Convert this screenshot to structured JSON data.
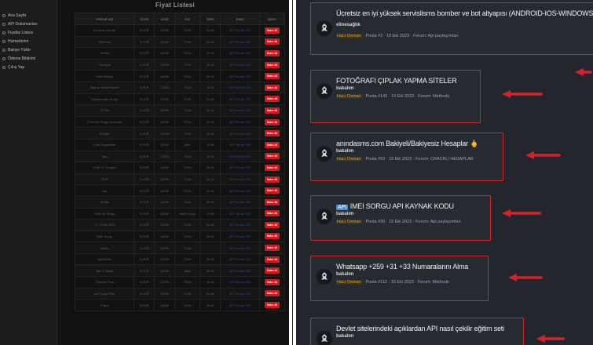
{
  "sidebar": {
    "items": [
      {
        "label": "Ana Sayfa"
      },
      {
        "label": "API Dokümanları"
      },
      {
        "label": "Fiyatlar Listesi"
      },
      {
        "label": "Hizmetlerim"
      },
      {
        "label": "Bakiye Yükle"
      },
      {
        "label": "Ödeme Bildirimi"
      },
      {
        "label": "Çıkış Yap"
      }
    ]
  },
  "content": {
    "title": "Fiyat Listesi",
    "table": {
      "headers": [
        "Hizmet Adı",
        "Ücret",
        "Limit",
        "Hız",
        "Süre",
        "Nasıl",
        "İşlem"
      ],
      "rows": [
        [
          "Ücretsiz Hizmet",
          "0,00 ₺",
          "10000",
          "7/24h",
          "10 dk",
          "API Servisi 100",
          "Satın Al"
        ],
        [
          "SMS Bot",
          "0,00 ₺",
          "10000",
          "7/24h",
          "10 dk",
          "API Servisi 100",
          "Satın Al"
        ],
        [
          "Yemek",
          "0,00 ₺",
          "10000",
          "7/24h",
          "10 dk",
          "API Servisi 100",
          "Satın Al"
        ],
        [
          "Trendyol",
          "0,00 ₺",
          "10000",
          "7/24h",
          "10 dk",
          "API Servisi 100",
          "Satın Al"
        ],
        [
          "Getir Market",
          "0,00 ₺",
          "10000",
          "7/24h",
          "10 dk",
          "API Servisi 100",
          "Satın Al"
        ],
        [
          "Migros Sanal Market",
          "0,00 ₺",
          "10000",
          "7/24h",
          "10 dk",
          "API Servisi 100",
          "Satın Al"
        ],
        [
          "Hepsiburada Sorgu",
          "0,00 ₺",
          "10000",
          "7/24h",
          "10 dk",
          "API Servisi 100",
          "Satın Al"
        ],
        [
          "TC Pro",
          "0,00 ₺",
          "10000",
          "7/24h",
          "10 dk",
          "API Servisi 100",
          "Satın Al"
        ],
        [
          "E-Devlet Sorgu & Hesap",
          "0,00 ₺",
          "10000",
          "7/24h",
          "10 dk",
          "API Servisi 100",
          "Satın Al"
        ],
        [
          "Ehliyet",
          "0,00 ₺",
          "10000",
          "7/24h",
          "10 dk",
          "API Servisi 100",
          "Satın Al"
        ],
        [
          "Sulu Sorgulama",
          "0,00 ₺",
          "10000",
          "Aktif",
          "10 dk",
          "API Servisi 100",
          "Satın Al"
        ],
        [
          "Tapu",
          "0,00 ₺",
          "10000",
          "7/24h",
          "10 dk",
          "API Servisi 100",
          "Satın Al"
        ],
        [
          "GSM TC Sorgulu",
          "0,00 ₺",
          "10000",
          "7/24h",
          "10 dk",
          "API Servisi 100",
          "Satın Al"
        ],
        [
          "SGK",
          "0,00 ₺",
          "10000",
          "7/24h",
          "10 dk",
          "API Servisi 100",
          "Satın Al"
        ],
        [
          "Aşı",
          "0,00 ₺",
          "10000",
          "7/24h",
          "10 dk",
          "API Servisi 100",
          "Satın Al"
        ],
        [
          "Kimlik",
          "0,00 ₺",
          "10000",
          "7/24h",
          "10 dk",
          "API Servisi 100",
          "Satın Al"
        ],
        [
          "Okul No Sorgu",
          "0,00 ₺",
          "10000",
          "Anlık Sorgu",
          "10 dk",
          "API Servisi 100",
          "Satın Al"
        ],
        [
          "TC GSM 2023",
          "0,00 ₺",
          "10000",
          "7/24h",
          "10 dk",
          "API Servisi 100",
          "Satın Al"
        ],
        [
          "IMEI Sorgu",
          "0,00 ₺",
          "10000",
          "7/24h",
          "10 dk",
          "API Servisi 100",
          "Satın Al"
        ],
        [
          "Adres",
          "0,00 ₺",
          "10000",
          "7/24h",
          "",
          "API Servisi 100",
          "Satın Al"
        ],
        [
          "Apartman",
          "0,00 ₺",
          "10000",
          "7/24h",
          "10 dk",
          "API Servisi 100",
          "Satın Al"
        ],
        [
          "Aile & Sülale",
          "0,00 ₺",
          "10000",
          "Aktif",
          "10 dk",
          "API Servisi 100",
          "Satın Al"
        ],
        [
          "Okul No Plus",
          "0,00 ₺",
          "10000",
          "7/24h",
          "10 dk",
          "API Servisi 100",
          "Satın Al"
        ],
        [
          "Ad Soyad Plus",
          "0,00 ₺",
          "10000",
          "7/24h",
          "10 dk",
          "API Servisi 100",
          "Satın Al"
        ],
        [
          "Plaka",
          "0,00 ₺",
          "10000",
          "7/24h",
          "10 dk",
          "API Servisi 100",
          "Satın Al"
        ]
      ]
    }
  },
  "posts": [
    {
      "title": "Ücretsiz en iyi yüksek servislisms bomber ve bot altyapısı (ANDROID-IOS-WINDOWS)",
      "user": "elinesağlık",
      "author": "Hacı Osman",
      "meta": " · Posta #2 · 16 Eki 2023 · Forum: Api paylaşımları"
    },
    {
      "title": "FOTOĞRAFI ÇIPLAK YAPMA SİTELER",
      "user": "bakalım",
      "author": "Hacı Osman",
      "meta": " · Posta #145 · 15 Eki 2023 · Forum: Methods"
    },
    {
      "title": "anındasms.com Bakiyeli/Bakiyesiz Hesaplar 🖕",
      "user": "bakalım",
      "author": "Hacı Osman",
      "meta": " · Posta #53 · 15 Eki 2023 · Forum: CRACKLI HESAPLAR"
    },
    {
      "tag": "API",
      "title": "IMEI SORGU API KAYNAK KODU",
      "user": "bakalım",
      "author": "Hacı Osman",
      "meta": " · Posta #30 · 15 Eki 2023 · Forum: Api paylaşımları"
    },
    {
      "title": "Whatsapp +259 +31 +33 Numaralarını Alma",
      "user": "bakalım",
      "author": "Hacı Osman",
      "meta": " · Posta #112 · 15 Eki 2023 · Forum: Methods"
    },
    {
      "title": "Devlet sitelerindeki açıklardan API nasıl çekilir eğitim seti",
      "user": "bakalım",
      "author": "",
      "meta": ""
    }
  ],
  "colors": {
    "highlight": "#d5222a",
    "author": "#e8a21c",
    "button": "#d9151b"
  }
}
